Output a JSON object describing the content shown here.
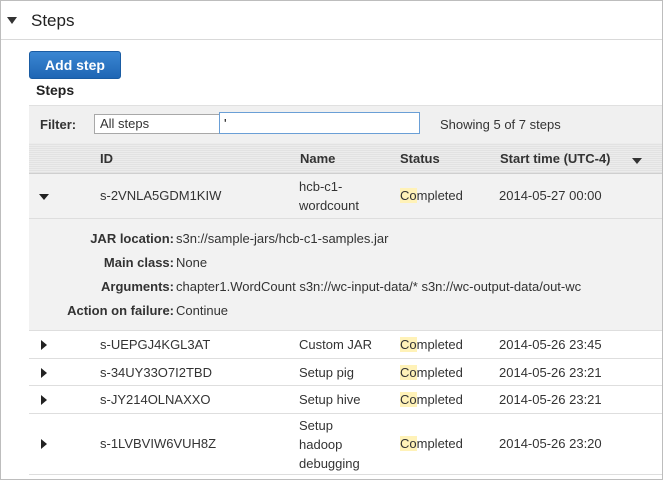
{
  "section": {
    "title": "Steps"
  },
  "toolbar": {
    "add_step_label": "Add step"
  },
  "steps_title": "Steps",
  "filter": {
    "label": "Filter:",
    "selected": "All steps",
    "text": "'",
    "showing": "Showing 5 of 7 steps"
  },
  "columns": {
    "id": "ID",
    "name": "Name",
    "status": "Status",
    "start_time": "Start time (UTC-4)"
  },
  "highlight_color": "#fff2b8",
  "rows": [
    {
      "id": "s-2VNLA5GDM1KIW",
      "name_lines": [
        "hcb-c1-",
        "wordcount"
      ],
      "status_hl": "Co",
      "status_rest": "mpleted",
      "start": "2014-05-27 00:00",
      "expanded": true
    },
    {
      "id": "s-UEPGJ4KGL3AT",
      "name_lines": [
        "Custom JAR"
      ],
      "status_hl": "Co",
      "status_rest": "mpleted",
      "start": "2014-05-26 23:45"
    },
    {
      "id": "s-34UY33O7I2TBD",
      "name_lines": [
        "Setup pig"
      ],
      "status_hl": "Co",
      "status_rest": "mpleted",
      "start": "2014-05-26 23:21"
    },
    {
      "id": "s-JY214OLNAXXO",
      "name_lines": [
        "Setup hive"
      ],
      "status_hl": "Co",
      "status_rest": "mpleted",
      "start": "2014-05-26 23:21"
    },
    {
      "id": "s-1LVBVIW6VUH8Z",
      "name_lines": [
        "Setup",
        "hadoop",
        "debugging"
      ],
      "status_hl": "Co",
      "status_rest": "mpleted",
      "start": "2014-05-26 23:20"
    }
  ],
  "details": {
    "jar_location": {
      "label": "JAR location:",
      "value": "s3n://sample-jars/hcb-c1-samples.jar"
    },
    "main_class": {
      "label": "Main class:",
      "value": "None"
    },
    "arguments": {
      "label": "Arguments:",
      "value": "chapter1.WordCount s3n://wc-input-data/* s3n://wc-output-data/out-wc"
    },
    "action_on_failure": {
      "label": "Action on failure:",
      "value": "Continue"
    }
  }
}
